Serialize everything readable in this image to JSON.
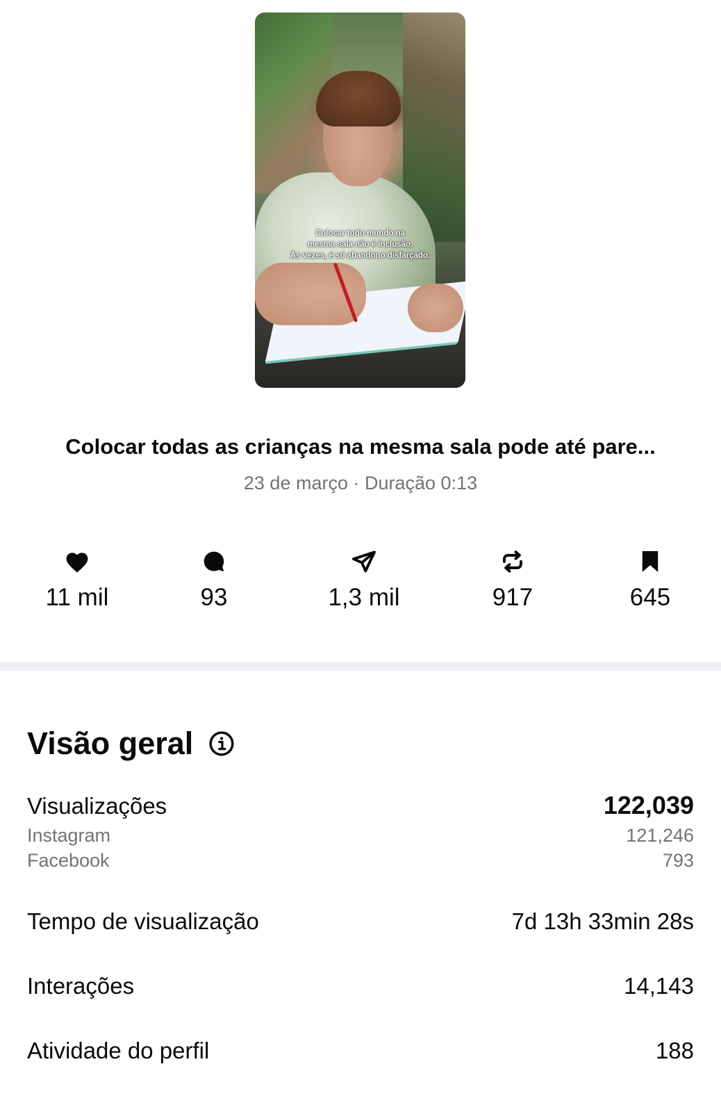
{
  "post": {
    "caption_lines": [
      "Colocar todo mundo na",
      "mesma sala não é inclusão.",
      "Às vezes, é só abandono disfarçado."
    ],
    "title": "Colocar todas as crianças na mesma sala pode até pare...",
    "date": "23 de março",
    "duration": "Duração 0:13"
  },
  "stats": {
    "likes": "11 mil",
    "comments": "93",
    "shares": "1,3 mil",
    "reposts": "917",
    "saves": "645"
  },
  "overview": {
    "title": "Visão geral",
    "views_label": "Visualizações",
    "views_total": "122,039",
    "instagram_label": "Instagram",
    "instagram_value": "121,246",
    "facebook_label": "Facebook",
    "facebook_value": "793",
    "watch_time_label": "Tempo de visualização",
    "watch_time_value": "7d 13h 33min 28s",
    "interactions_label": "Interações",
    "interactions_value": "14,143",
    "profile_activity_label": "Atividade do perfil",
    "profile_activity_value": "188"
  },
  "colors": {
    "primary_text": "#0a0a0a",
    "secondary_text": "#737373",
    "divider": "#eef0f3"
  }
}
